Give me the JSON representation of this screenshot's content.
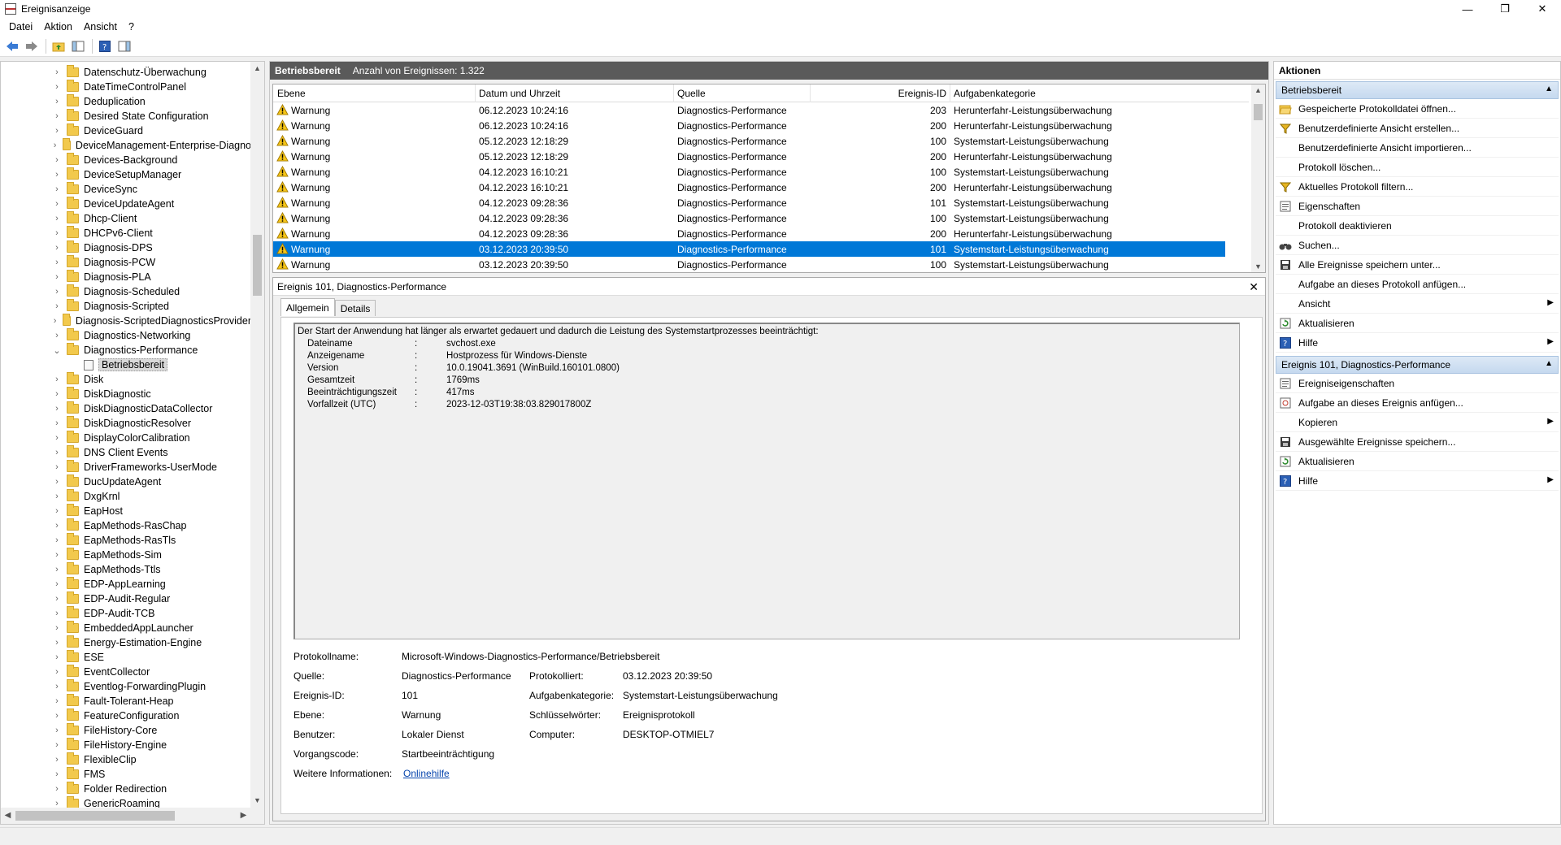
{
  "window": {
    "title": "Ereignisanzeige",
    "minimize": "—",
    "maximize": "❐",
    "close": "✕"
  },
  "menu": [
    "Datei",
    "Aktion",
    "Ansicht",
    "?"
  ],
  "tree": {
    "items": [
      "Datenschutz-Überwachung",
      "DateTimeControlPanel",
      "Deduplication",
      "Desired State Configuration",
      "DeviceGuard",
      "DeviceManagement-Enterprise-Diagno",
      "Devices-Background",
      "DeviceSetupManager",
      "DeviceSync",
      "DeviceUpdateAgent",
      "Dhcp-Client",
      "DHCPv6-Client",
      "Diagnosis-DPS",
      "Diagnosis-PCW",
      "Diagnosis-PLA",
      "Diagnosis-Scheduled",
      "Diagnosis-Scripted",
      "Diagnosis-ScriptedDiagnosticsProvider",
      "Diagnostics-Networking",
      "Diagnostics-Performance"
    ],
    "expanded_child": "Betriebsbereit",
    "items_after": [
      "Disk",
      "DiskDiagnostic",
      "DiskDiagnosticDataCollector",
      "DiskDiagnosticResolver",
      "DisplayColorCalibration",
      "DNS Client Events",
      "DriverFrameworks-UserMode",
      "DucUpdateAgent",
      "DxgKrnl",
      "EapHost",
      "EapMethods-RasChap",
      "EapMethods-RasTls",
      "EapMethods-Sim",
      "EapMethods-Ttls",
      "EDP-AppLearning",
      "EDP-Audit-Regular",
      "EDP-Audit-TCB",
      "EmbeddedAppLauncher",
      "Energy-Estimation-Engine",
      "ESE",
      "EventCollector",
      "Eventlog-ForwardingPlugin",
      "Fault-Tolerant-Heap",
      "FeatureConfiguration",
      "FileHistory-Core",
      "FileHistory-Engine",
      "FlexibleClip",
      "FMS",
      "Folder Redirection",
      "GenericRoaming"
    ]
  },
  "log_header": {
    "name": "Betriebsbereit",
    "count": "Anzahl von Ereignissen: 1.322"
  },
  "columns": {
    "level": "Ebene",
    "date": "Datum und Uhrzeit",
    "source": "Quelle",
    "id": "Ereignis-ID",
    "category": "Aufgabenkategorie"
  },
  "events": [
    {
      "level": "Warnung",
      "date": "06.12.2023 10:24:16",
      "source": "Diagnostics-Performance",
      "id": "203",
      "category": "Herunterfahr-Leistungsüberwachung"
    },
    {
      "level": "Warnung",
      "date": "06.12.2023 10:24:16",
      "source": "Diagnostics-Performance",
      "id": "200",
      "category": "Herunterfahr-Leistungsüberwachung"
    },
    {
      "level": "Warnung",
      "date": "05.12.2023 12:18:29",
      "source": "Diagnostics-Performance",
      "id": "100",
      "category": "Systemstart-Leistungsüberwachung"
    },
    {
      "level": "Warnung",
      "date": "05.12.2023 12:18:29",
      "source": "Diagnostics-Performance",
      "id": "200",
      "category": "Herunterfahr-Leistungsüberwachung"
    },
    {
      "level": "Warnung",
      "date": "04.12.2023 16:10:21",
      "source": "Diagnostics-Performance",
      "id": "100",
      "category": "Systemstart-Leistungsüberwachung"
    },
    {
      "level": "Warnung",
      "date": "04.12.2023 16:10:21",
      "source": "Diagnostics-Performance",
      "id": "200",
      "category": "Herunterfahr-Leistungsüberwachung"
    },
    {
      "level": "Warnung",
      "date": "04.12.2023 09:28:36",
      "source": "Diagnostics-Performance",
      "id": "101",
      "category": "Systemstart-Leistungsüberwachung"
    },
    {
      "level": "Warnung",
      "date": "04.12.2023 09:28:36",
      "source": "Diagnostics-Performance",
      "id": "100",
      "category": "Systemstart-Leistungsüberwachung"
    },
    {
      "level": "Warnung",
      "date": "04.12.2023 09:28:36",
      "source": "Diagnostics-Performance",
      "id": "200",
      "category": "Herunterfahr-Leistungsüberwachung"
    },
    {
      "level": "Warnung",
      "date": "03.12.2023 20:39:50",
      "source": "Diagnostics-Performance",
      "id": "101",
      "category": "Systemstart-Leistungsüberwachung"
    },
    {
      "level": "Warnung",
      "date": "03.12.2023 20:39:50",
      "source": "Diagnostics-Performance",
      "id": "100",
      "category": "Systemstart-Leistungsüberwachung"
    }
  ],
  "selected_row": 9,
  "detail": {
    "title": "Ereignis 101, Diagnostics-Performance",
    "close": "✕",
    "tab_general": "Allgemein",
    "tab_details": "Details",
    "message": "Der Start der Anwendung hat länger als erwartet gedauert und dadurch die Leistung des Systemstartprozesses beeinträchtigt:",
    "fields": [
      {
        "k": "Dateiname",
        "v": "svchost.exe"
      },
      {
        "k": "Anzeigename",
        "v": "Hostprozess für Windows-Dienste"
      },
      {
        "k": "Version",
        "v": "10.0.19041.3691 (WinBuild.160101.0800)"
      },
      {
        "k": "Gesamtzeit",
        "v": "1769ms"
      },
      {
        "k": "Beeinträchtigungszeit",
        "v": "417ms"
      },
      {
        "k": "Vorfallzeit (UTC)",
        "v": "2023-12-03T19:38:03.829017800Z"
      }
    ],
    "colon": ":",
    "props": {
      "logname_label": "Protokollname:",
      "logname": "Microsoft-Windows-Diagnostics-Performance/Betriebsbereit",
      "source_label": "Quelle:",
      "source": "Diagnostics-Performance",
      "logged_label": "Protokolliert:",
      "logged": "03.12.2023 20:39:50",
      "id_label": "Ereignis-ID:",
      "id": "101",
      "category_label": "Aufgabenkategorie:",
      "category": "Systemstart-Leistungsüberwachung",
      "level_label": "Ebene:",
      "level": "Warnung",
      "keywords_label": "Schlüsselwörter:",
      "keywords": "Ereignisprotokoll",
      "user_label": "Benutzer:",
      "user": "Lokaler Dienst",
      "computer_label": "Computer:",
      "computer": "DESKTOP-OTMIEL7",
      "opcode_label": "Vorgangscode:",
      "opcode": "Startbeeinträchtigung",
      "more_label": "Weitere Informationen:",
      "more_link": "Onlinehilfe"
    }
  },
  "actions": {
    "title": "Aktionen",
    "section1": "Betriebsbereit",
    "items1": [
      {
        "label": "Gespeicherte Protokolldatei öffnen...",
        "icon": "folder-open-icon",
        "arrow": false
      },
      {
        "label": "Benutzerdefinierte Ansicht erstellen...",
        "icon": "filter-icon",
        "arrow": false
      },
      {
        "label": "Benutzerdefinierte Ansicht importieren...",
        "icon": "",
        "arrow": false
      },
      {
        "label": "Protokoll löschen...",
        "icon": "",
        "arrow": false
      },
      {
        "label": "Aktuelles Protokoll filtern...",
        "icon": "filter-icon",
        "arrow": false
      },
      {
        "label": "Eigenschaften",
        "icon": "properties-icon",
        "arrow": false
      },
      {
        "label": "Protokoll deaktivieren",
        "icon": "",
        "arrow": false
      },
      {
        "label": "Suchen...",
        "icon": "binoculars-icon",
        "arrow": false
      },
      {
        "label": "Alle Ereignisse speichern unter...",
        "icon": "save-icon",
        "arrow": false
      },
      {
        "label": "Aufgabe an dieses Protokoll anfügen...",
        "icon": "",
        "arrow": false
      },
      {
        "label": "Ansicht",
        "icon": "",
        "arrow": true
      },
      {
        "label": "Aktualisieren",
        "icon": "refresh-icon",
        "arrow": false
      },
      {
        "label": "Hilfe",
        "icon": "help-icon",
        "arrow": true
      }
    ],
    "section2": "Ereignis 101, Diagnostics-Performance",
    "items2": [
      {
        "label": "Ereigniseigenschaften",
        "icon": "properties-icon",
        "arrow": false
      },
      {
        "label": "Aufgabe an dieses Ereignis anfügen...",
        "icon": "task-icon",
        "arrow": false
      },
      {
        "label": "Kopieren",
        "icon": "",
        "arrow": true
      },
      {
        "label": "Ausgewählte Ereignisse speichern...",
        "icon": "save-icon",
        "arrow": false
      },
      {
        "label": "Aktualisieren",
        "icon": "refresh-icon",
        "arrow": false
      },
      {
        "label": "Hilfe",
        "icon": "help-icon",
        "arrow": true
      }
    ]
  }
}
